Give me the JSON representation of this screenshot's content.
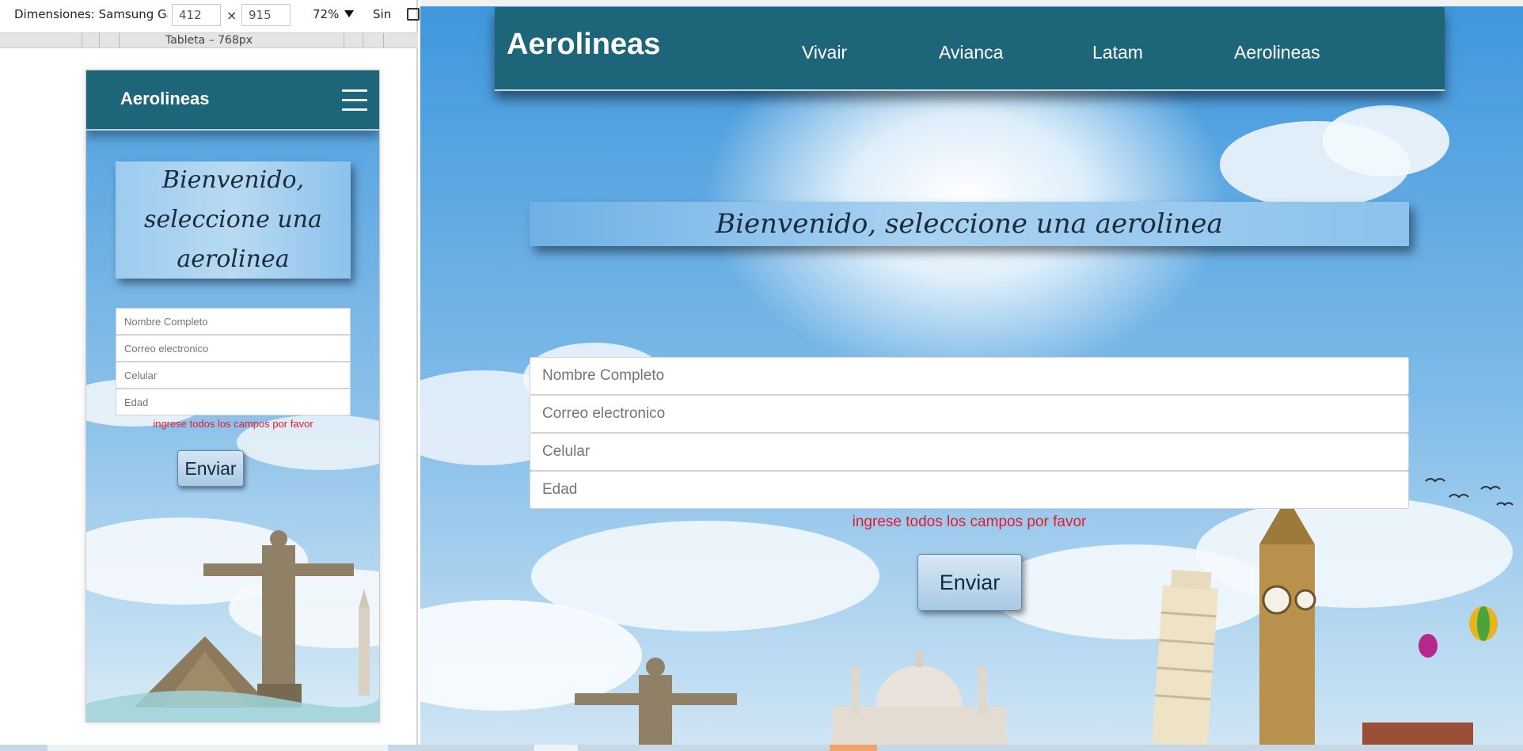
{
  "devtools": {
    "device_label": "Dimensiones: Samsung Galaxy",
    "width_value": "412",
    "height_value": "915",
    "times_sign": "×",
    "zoom": "72%",
    "throttle": "Sin",
    "ruler_label": "Tableta – 768px"
  },
  "phone": {
    "brand": "Aerolineas",
    "welcome_title": "Bienvenido, seleccione una aerolinea",
    "fields": [
      {
        "placeholder": "Nombre Completo"
      },
      {
        "placeholder": "Correo electronico"
      },
      {
        "placeholder": "Celular"
      },
      {
        "placeholder": "Edad"
      }
    ],
    "error": "ingrese todos los campos por favor",
    "submit": "Enviar"
  },
  "desktop": {
    "brand": "Aerolineas",
    "nav": [
      "Vivair",
      "Avianca",
      "Latam",
      "Aerolineas"
    ],
    "welcome_title": "Bienvenido, seleccione una aerolinea",
    "fields": [
      {
        "placeholder": "Nombre Completo"
      },
      {
        "placeholder": "Correo electronico"
      },
      {
        "placeholder": "Celular"
      },
      {
        "placeholder": "Edad"
      }
    ],
    "error": "ingrese todos los campos por favor",
    "submit": "Enviar"
  },
  "colors": {
    "header": "#1d667a",
    "error": "#e41b2c",
    "sky": "#79b8e8"
  }
}
